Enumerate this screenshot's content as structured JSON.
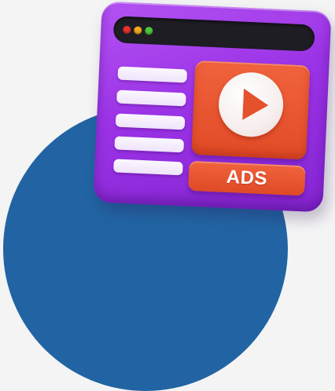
{
  "illustration": {
    "background_color": "#f4f4f5",
    "circle_color": "#2264a3",
    "window": {
      "frame_color": "#9b33e6",
      "titlebar_color": "#1f1d24",
      "traffic_lights": [
        {
          "name": "close",
          "color": "#e5322b"
        },
        {
          "name": "minimize",
          "color": "#f2a81e"
        },
        {
          "name": "maximize",
          "color": "#4cc73a"
        }
      ],
      "text_lines": 5,
      "video_panel": {
        "color": "#e9552f",
        "icon": "play-icon"
      },
      "ads_button": {
        "label": "ADS",
        "color": "#e9552f"
      }
    }
  }
}
